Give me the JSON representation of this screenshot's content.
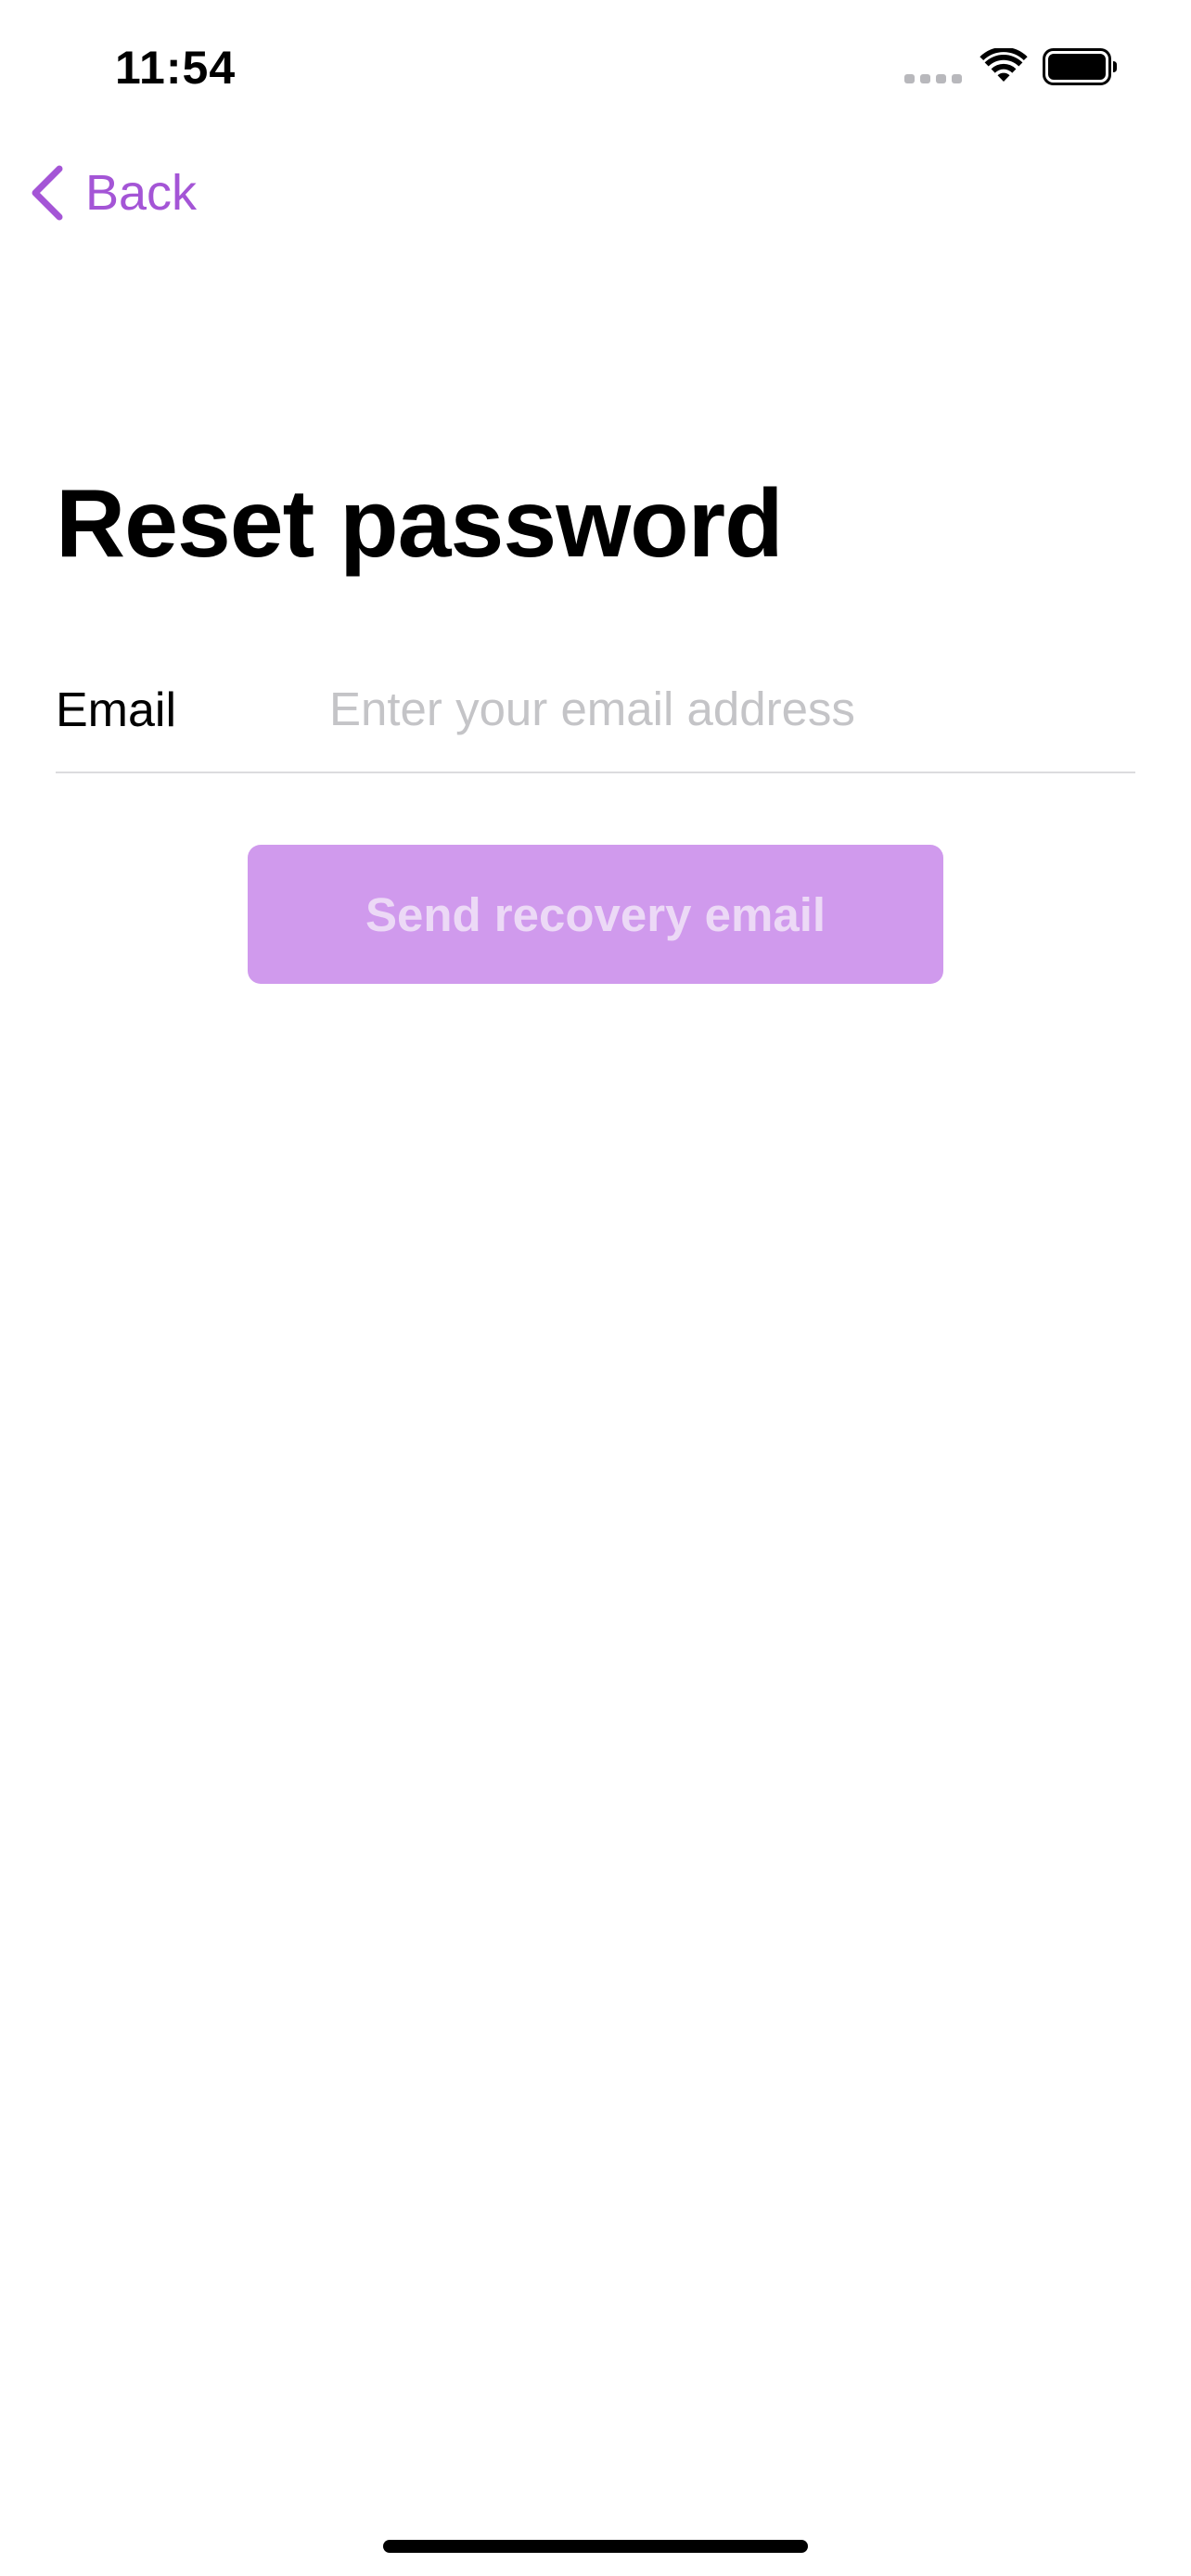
{
  "status_bar": {
    "time": "11:54"
  },
  "nav": {
    "back_label": "Back",
    "accent_color": "#a455d6"
  },
  "page": {
    "title": "Reset password"
  },
  "form": {
    "email_label": "Email",
    "email_value": "",
    "email_placeholder": "Enter your email address",
    "submit_label": "Send recovery email",
    "submit_enabled": false,
    "submit_color": "#d09aed"
  },
  "icons": {
    "cell_signal": "cell-signal-icon",
    "wifi": "wifi-icon",
    "battery": "battery-icon",
    "back": "chevron-left-icon"
  }
}
